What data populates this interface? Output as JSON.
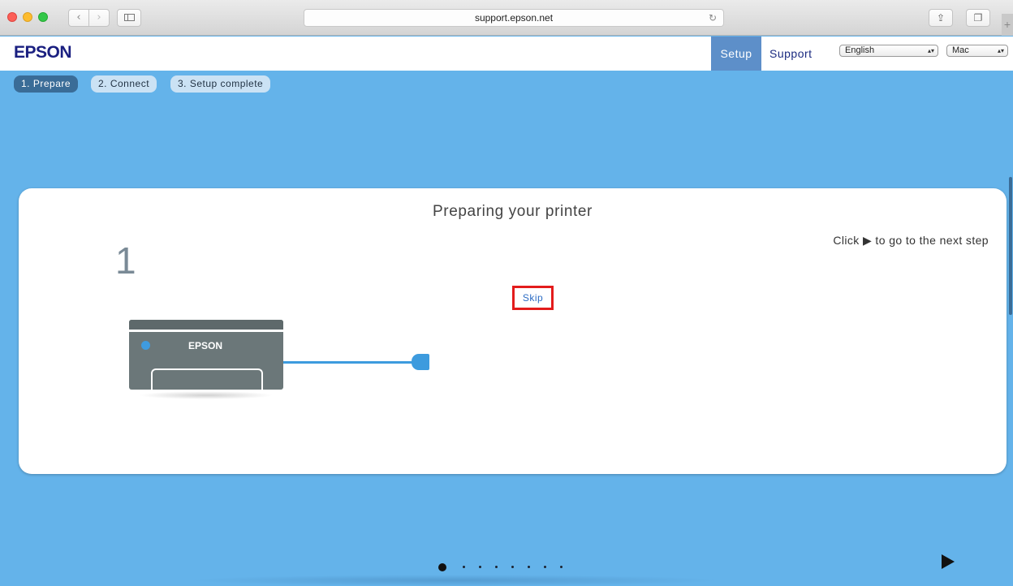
{
  "browser": {
    "url": "support.epson.net",
    "back_icon": "chevron-left-icon",
    "forward_icon": "chevron-right-icon",
    "reload_icon": "reload-icon",
    "share_icon": "share-icon",
    "tabs_icon": "tabs-icon",
    "newtab_icon": "plus-icon"
  },
  "header": {
    "logo": "EPSON",
    "nav": {
      "setup": "Setup",
      "support": "Support"
    },
    "language_select": "English",
    "os_select": "Mac",
    "accent_color": "#5d8fc9",
    "logo_color": "#1a1f80"
  },
  "steps": [
    {
      "label": "1. Prepare",
      "active": true
    },
    {
      "label": "2. Connect",
      "active": false
    },
    {
      "label": "3. Setup complete",
      "active": false
    }
  ],
  "card": {
    "title": "Preparing your printer",
    "hint": "Click ▶ to go to the next step",
    "step_number": "1",
    "skip_label": "Skip",
    "printer_brand": "EPSON"
  },
  "pagination": {
    "total": 8,
    "current": 1,
    "next_icon": "play-arrow-icon"
  },
  "colors": {
    "page_background": "#64b3ea",
    "highlight_border": "#e31c1c"
  }
}
